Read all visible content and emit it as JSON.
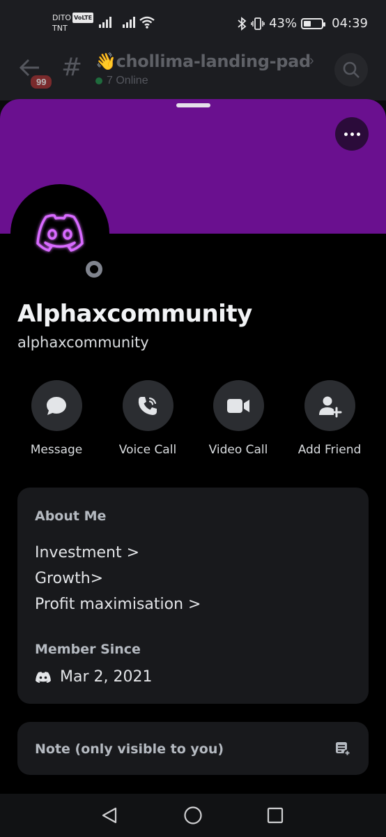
{
  "status_bar": {
    "carrier_1": "DITO",
    "volte": "VoLTE",
    "carrier_2": "TNT",
    "battery_percent": "43%",
    "battery_level": 0.43,
    "time": "04:39"
  },
  "channel": {
    "unread_badge": "99",
    "emoji": "👋",
    "name": "chollima-landing-pad",
    "online": "7 Online"
  },
  "profile": {
    "banner_color": "#6a108f",
    "display_name": "Alphaxcommunity",
    "username": "alphaxcommunity",
    "status": "offline",
    "actions": [
      {
        "label": "Message",
        "icon": "message-icon"
      },
      {
        "label": "Voice Call",
        "icon": "phone-icon"
      },
      {
        "label": "Video Call",
        "icon": "video-camera-icon"
      },
      {
        "label": "Add Friend",
        "icon": "add-friend-icon"
      }
    ],
    "about_me": {
      "title": "About Me",
      "lines": [
        "Investment >",
        "Growth>",
        "Profit maximisation >"
      ]
    },
    "member_since": {
      "title": "Member Since",
      "date": "Mar 2, 2021"
    },
    "note": {
      "title": "Note (only visible to you)"
    }
  },
  "colors": {
    "accent_purple": "#6a108f",
    "card_bg": "#18191c",
    "button_bg": "#2b2d31",
    "avatar_glow": "#c84bff"
  }
}
